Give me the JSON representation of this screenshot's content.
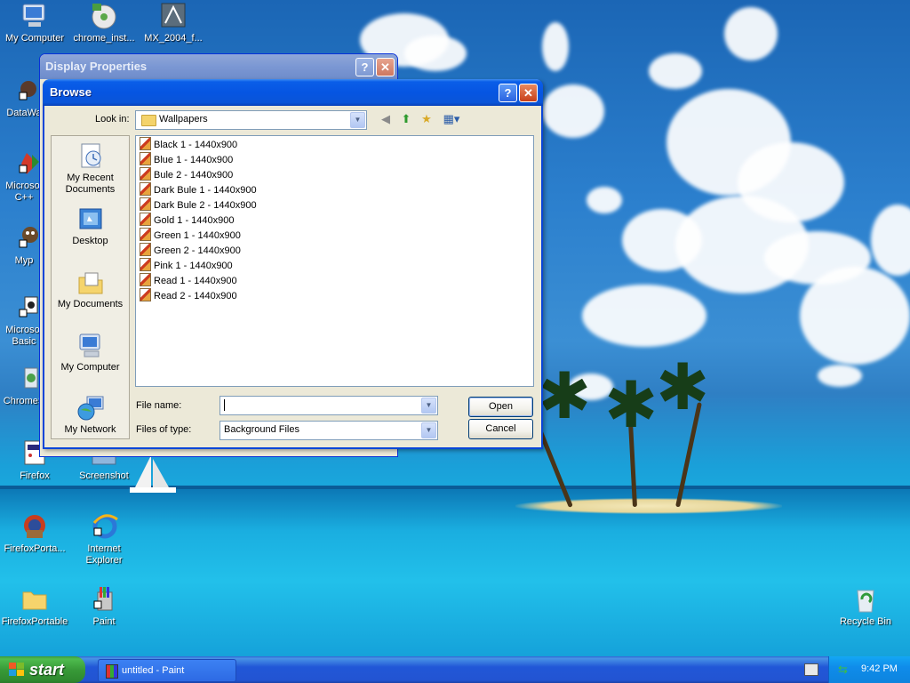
{
  "desktop": {
    "icons": [
      {
        "label": "My Computer"
      },
      {
        "label": "chrome_inst..."
      },
      {
        "label": "MX_2004_f..."
      },
      {
        "label": "DataWa"
      },
      {
        "label": "Microsof"
      },
      {
        "label": "C++"
      },
      {
        "label": "Myp"
      },
      {
        "label": "Microsof"
      },
      {
        "label": "Basic"
      },
      {
        "label": "ChromeS"
      },
      {
        "label": "Firefox"
      },
      {
        "label": "Screenshot"
      },
      {
        "label": "FirefoxPorta..."
      },
      {
        "label": "Internet"
      },
      {
        "label": "Explorer"
      },
      {
        "label": "FirefoxPortable"
      },
      {
        "label": "Paint"
      },
      {
        "label": "Recycle Bin"
      }
    ]
  },
  "display_properties": {
    "title": "Display Properties",
    "help": "?",
    "close": "✕"
  },
  "browse": {
    "title": "Browse",
    "help": "?",
    "close": "✕",
    "look_in_label": "Look in:",
    "look_in_value": "Wallpapers",
    "places": [
      {
        "line1": "My Recent",
        "line2": "Documents"
      },
      {
        "line1": "Desktop"
      },
      {
        "line1": "My Documents"
      },
      {
        "line1": "My Computer"
      },
      {
        "line1": "My Network"
      }
    ],
    "files": [
      "Black 1 - 1440x900",
      "Blue 1 - 1440x900",
      "Bule 2 - 1440x900",
      "Dark Bule 1 - 1440x900",
      "Dark Bule 2 - 1440x900",
      "Gold 1 - 1440x900",
      "Green 1 - 1440x900",
      "Green 2 - 1440x900",
      "Pink 1 - 1440x900",
      "Read 1 - 1440x900",
      "Read 2 - 1440x900"
    ],
    "file_name_label": "File name:",
    "file_name_value": "",
    "file_type_label": "Files of type:",
    "file_type_value": "Background Files",
    "open_label": "Open",
    "cancel_label": "Cancel"
  },
  "taskbar": {
    "start_label": "start",
    "tasks": [
      {
        "label": "untitled - Paint"
      }
    ],
    "clock": "9:42 PM"
  },
  "colors": {
    "titlebar_active": "#0655e2",
    "titlebar_inactive": "#7b97d3",
    "dialog_bg": "#ece9d8",
    "taskbar": "#2254d2",
    "start_green": "#389a38"
  }
}
